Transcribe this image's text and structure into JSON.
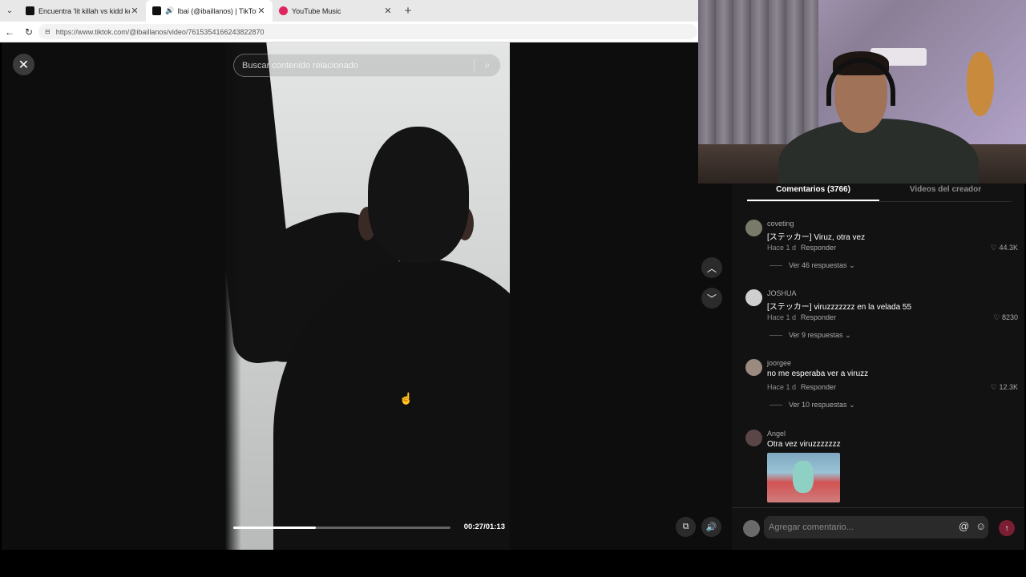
{
  "browser": {
    "tabs": [
      {
        "label": "Encuentra 'lit killah vs kidd keo' en",
        "active": false,
        "icon": "tiktok-icon"
      },
      {
        "label": "Ibai (@ibaillanos) | TikTok",
        "active": true,
        "icon": "tiktok-icon"
      },
      {
        "label": "YouTube Music",
        "active": false,
        "icon": "youtube-music-icon"
      }
    ],
    "url": "https://www.tiktok.com/@ibaillanos/video/7615354166243822870"
  },
  "video": {
    "search_placeholder": "Buscar contenido relacionado",
    "timecode": "00:27/01:13",
    "progress": 0.38
  },
  "panel": {
    "tabs": [
      {
        "label": "Comentarios (3766)",
        "active": true
      },
      {
        "label": "Videos del creador",
        "active": false
      }
    ],
    "comments": [
      {
        "user": "coveting",
        "text": "[ステッカー] Viruz, otra vez",
        "time": "Hace 1 d",
        "reply": "Responder",
        "likes": "44.3K",
        "more": "Ver 46 respuestas"
      },
      {
        "user": "JOSHUA",
        "text": "[ステッカー] viruzzzzzzz en la velada 55",
        "time": "Hace 1 d",
        "reply": "Responder",
        "likes": "8230",
        "more": "Ver 9 respuestas"
      },
      {
        "user": "joorgee",
        "text": "no me esperaba ver a viruzz",
        "time": "Hace 1 d",
        "reply": "Responder",
        "likes": "12.3K",
        "more": "Ver 10 respuestas"
      },
      {
        "user": "Angel",
        "text": "Otra vez viruzzzzzzz"
      }
    ],
    "composer_placeholder": "Agregar comentario..."
  }
}
